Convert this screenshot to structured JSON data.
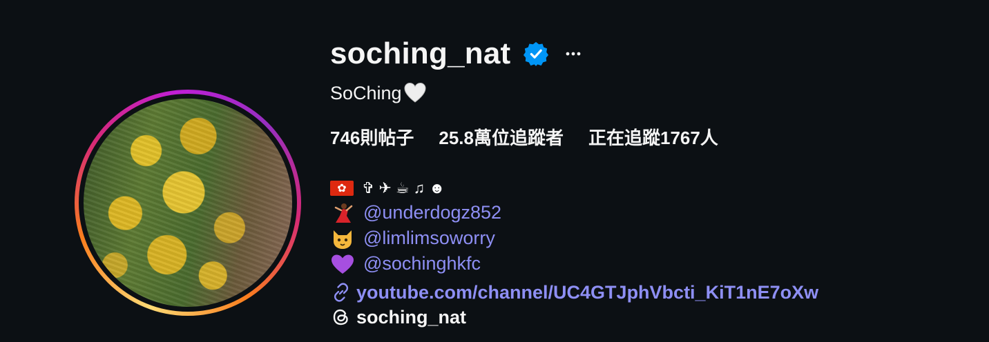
{
  "profile": {
    "username": "soching_nat",
    "full_name": "SoChing",
    "verified": true,
    "accent_color": "#0095f6"
  },
  "stats": {
    "posts": "746則帖子",
    "followers": "25.8萬位追蹤者",
    "following": "正在追蹤1767人"
  },
  "bio": {
    "symbols": [
      "✞",
      "✈",
      "☕",
      "♫",
      "☻"
    ],
    "mentions": [
      {
        "emoji": "dancer",
        "handle": "@underdogz852"
      },
      {
        "emoji": "cat",
        "handle": "@limlimsoworry"
      },
      {
        "emoji": "purple-heart",
        "handle": "@sochinghkfc"
      }
    ]
  },
  "link": {
    "url_text": "youtube.com/channel/UC4GTJphVbcti_KiT1nE7oXw"
  },
  "threads": {
    "handle": "soching_nat"
  },
  "colors": {
    "background": "#0c1014",
    "link": "#8e8ff4",
    "text": "#f5f5f5"
  }
}
